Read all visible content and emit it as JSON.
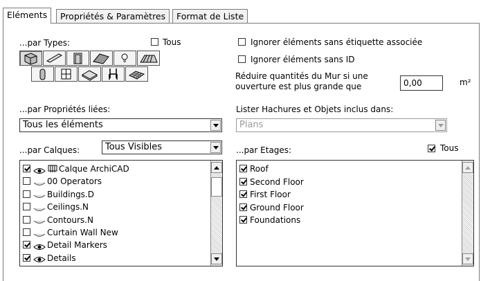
{
  "tabs": [
    {
      "label": "Eléments",
      "active": true
    },
    {
      "label": "Propriétés & Paramètres",
      "active": false
    },
    {
      "label": "Format de Liste",
      "active": false
    }
  ],
  "types": {
    "label": "...par Types:",
    "all_label": "Tous",
    "all_checked": false,
    "icons": [
      {
        "name": "wall-tool-icon",
        "selected": true
      },
      {
        "name": "beam-tool-icon",
        "selected": false
      },
      {
        "name": "door-tool-icon",
        "selected": false
      },
      {
        "name": "roof-tool-icon",
        "selected": false
      },
      {
        "name": "lamp-tool-icon",
        "selected": false
      },
      {
        "name": "stair-tool-icon",
        "selected": false
      },
      {
        "name": "column-tool-icon",
        "selected": false
      },
      {
        "name": "window-tool-icon",
        "selected": false
      },
      {
        "name": "slab-tool-icon",
        "selected": false
      },
      {
        "name": "object-tool-icon",
        "selected": false
      },
      {
        "name": "mesh-tool-icon",
        "selected": false
      }
    ]
  },
  "options": {
    "ignore_no_label": "Ignorer éléments sans étiquette associée",
    "ignore_no_label_checked": false,
    "ignore_no_id": "Ignorer éléments sans ID",
    "ignore_no_id_checked": false,
    "reduce_line1": "Réduire quantités du Mur si une",
    "reduce_line2": "ouverture est plus grande que",
    "reduce_value": "0,00",
    "reduce_unit": "m²"
  },
  "linked": {
    "label": "...par Propriétés liées:",
    "value": "Tous les éléments"
  },
  "hatches": {
    "label": "Lister Hachures et Objets inclus dans:",
    "value": "Plans",
    "disabled": true
  },
  "layers": {
    "label": "...par Calques:",
    "combo_value": "Tous Visibles",
    "items": [
      {
        "checked": true,
        "visible": true,
        "special": true,
        "label": "Calque ArchiCAD"
      },
      {
        "checked": false,
        "visible": false,
        "special": false,
        "label": "00 Operators"
      },
      {
        "checked": false,
        "visible": false,
        "special": false,
        "label": "Buildings.D"
      },
      {
        "checked": false,
        "visible": false,
        "special": false,
        "label": "Ceilings.N"
      },
      {
        "checked": false,
        "visible": false,
        "special": false,
        "label": "Contours.N"
      },
      {
        "checked": false,
        "visible": false,
        "special": false,
        "label": "Curtain Wall New"
      },
      {
        "checked": true,
        "visible": true,
        "special": false,
        "label": "Detail Markers"
      },
      {
        "checked": true,
        "visible": true,
        "special": false,
        "label": "Details"
      }
    ]
  },
  "stories": {
    "label": "...par Etages:",
    "all_label": "Tous",
    "all_checked": true,
    "items": [
      {
        "checked": true,
        "label": "Roof"
      },
      {
        "checked": true,
        "label": "Second Floor"
      },
      {
        "checked": true,
        "label": "First Floor"
      },
      {
        "checked": true,
        "label": "Ground Floor"
      },
      {
        "checked": true,
        "label": "Foundations"
      }
    ]
  }
}
